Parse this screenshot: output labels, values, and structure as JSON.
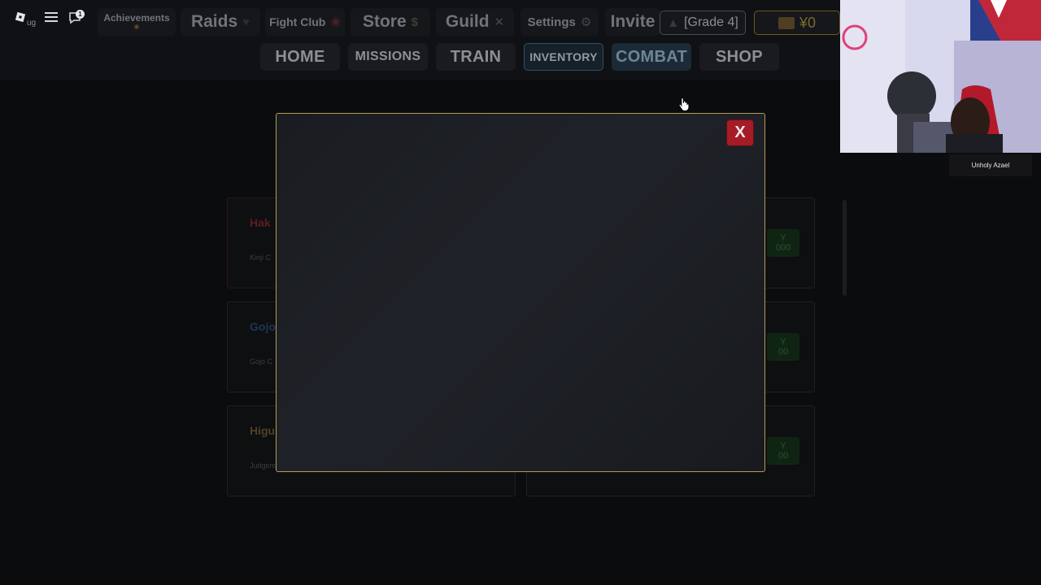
{
  "system": {
    "roblox_icon": "roblox-logo-icon",
    "menu_icon": "hamburger-menu-icon",
    "chat_icon": "chat-icon",
    "chat_badge": "1",
    "truncated_label": "ug"
  },
  "topbar": {
    "achievements": {
      "label": "Achievements",
      "icon": "sparkle-icon"
    },
    "raids": {
      "label": "Raids",
      "icon": "heart-icon"
    },
    "fight_club": {
      "label": "Fight Club",
      "icon": "rose-icon"
    },
    "store": {
      "label": "Store",
      "icon": "money-icon"
    },
    "guild": {
      "label": "Guild",
      "icon": "crossed-swords-icon"
    },
    "settings": {
      "label": "Settings",
      "icon": "gear-icon"
    },
    "invite": {
      "label": "Invite"
    },
    "grade": {
      "label": "[Grade 4]",
      "icon": "graduation-cap-icon"
    },
    "currency": {
      "label": "¥0",
      "icon": "box-icon"
    }
  },
  "nav": {
    "home": "HOME",
    "missions": "MISSIONS",
    "train": "TRAIN",
    "inventory": "INVENTORY",
    "combat": "COMBAT",
    "shop": "SHOP"
  },
  "cards": [
    {
      "name": "Hak",
      "sub": "Kinji C"
    },
    {
      "name": "Gojo",
      "sub": "Gojo C"
    },
    {
      "name": "Higu",
      "sub": "Judgem"
    }
  ],
  "right_cards": [
    {
      "buy": "Y\n000"
    },
    {
      "buy": "Y\n00"
    },
    {
      "buy": "Y\n00"
    }
  ],
  "modal": {
    "close_label": "X"
  },
  "webcam": {
    "caption": "Unholy Azael"
  },
  "colors": {
    "modal_border": "#b49a55",
    "close_red": "#a51c27",
    "accent_blue": "#2f4f6a"
  }
}
